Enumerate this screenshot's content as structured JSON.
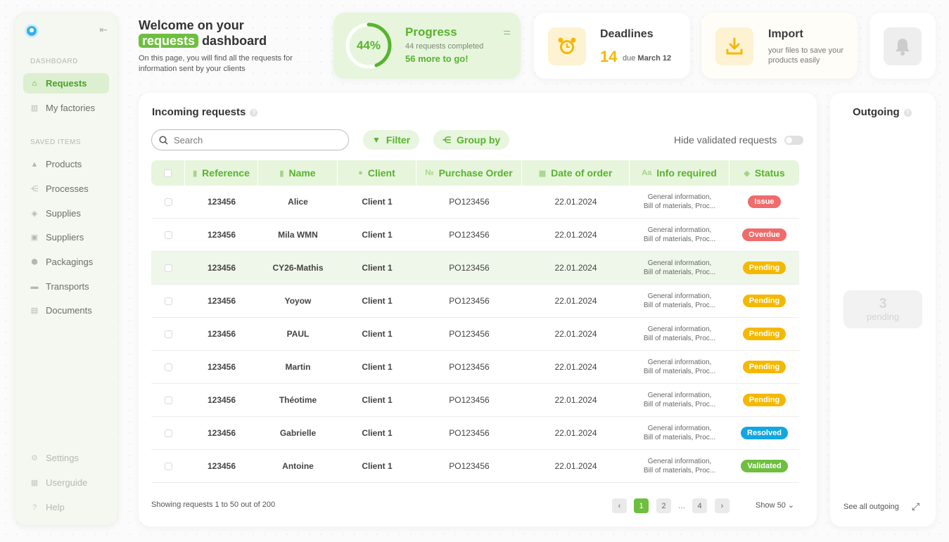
{
  "sidebar": {
    "section_dashboard": "DASHBOARD",
    "section_saved": "SAVED ITEMS",
    "items": [
      {
        "label": "Requests",
        "icon": "home-icon"
      },
      {
        "label": "My factories",
        "icon": "factory-icon"
      },
      {
        "label": "Products",
        "icon": "boxes-icon"
      },
      {
        "label": "Processes",
        "icon": "process-icon"
      },
      {
        "label": "Supplies",
        "icon": "layers-icon"
      },
      {
        "label": "Suppliers",
        "icon": "contact-icon"
      },
      {
        "label": "Packagings",
        "icon": "package-icon"
      },
      {
        "label": "Transports",
        "icon": "truck-icon"
      },
      {
        "label": "Documents",
        "icon": "document-icon"
      },
      {
        "label": "Settings",
        "icon": "gear-icon"
      },
      {
        "label": "Userguide",
        "icon": "book-icon"
      },
      {
        "label": "Help",
        "icon": "help-icon"
      }
    ]
  },
  "welcome": {
    "title_1": "Welcome on your",
    "title_highlight": "requests",
    "title_2": "dashboard",
    "desc": "On this page, you will find all the requests for information sent by your clients"
  },
  "progress": {
    "percent_label": "44%",
    "value": 0.44,
    "title": "Progress",
    "sub": "44 requests completed",
    "more": "56 more to go!"
  },
  "deadlines": {
    "title": "Deadlines",
    "count": "14",
    "due": "due",
    "date": "March 12"
  },
  "import": {
    "title": "Import",
    "sub": "your files to save your products easily"
  },
  "incoming": {
    "title": "Incoming requests",
    "search_placeholder": "Search",
    "filter_label": "Filter",
    "groupby_label": "Group by",
    "hide_label": "Hide validated requests",
    "columns": [
      "Reference",
      "Name",
      "Client",
      "Purchase Order",
      "Date of order",
      "Info required",
      "Status"
    ],
    "rows": [
      {
        "ref": "123456",
        "name": "Alice",
        "client": "Client 1",
        "po": "PO123456",
        "date": "22.01.2024",
        "info1": "General information,",
        "info2": "Bill of materials, Proc...",
        "status": "Issue"
      },
      {
        "ref": "123456",
        "name": "Mila WMN",
        "client": "Client 1",
        "po": "PO123456",
        "date": "22.01.2024",
        "info1": "General information,",
        "info2": "Bill of materials, Proc...",
        "status": "Overdue"
      },
      {
        "ref": "123456",
        "name": "CY26-Mathis",
        "client": "Client 1",
        "po": "PO123456",
        "date": "22.01.2024",
        "info1": "General information,",
        "info2": "Bill of materials, Proc...",
        "status": "Pending"
      },
      {
        "ref": "123456",
        "name": "Yoyow",
        "client": "Client 1",
        "po": "PO123456",
        "date": "22.01.2024",
        "info1": "General information,",
        "info2": "Bill of materials, Proc...",
        "status": "Pending"
      },
      {
        "ref": "123456",
        "name": "PAUL",
        "client": "Client 1",
        "po": "PO123456",
        "date": "22.01.2024",
        "info1": "General information,",
        "info2": "Bill of materials, Proc...",
        "status": "Pending"
      },
      {
        "ref": "123456",
        "name": "Martin",
        "client": "Client 1",
        "po": "PO123456",
        "date": "22.01.2024",
        "info1": "General information,",
        "info2": "Bill of materials, Proc...",
        "status": "Pending"
      },
      {
        "ref": "123456",
        "name": "Théotime",
        "client": "Client 1",
        "po": "PO123456",
        "date": "22.01.2024",
        "info1": "General information,",
        "info2": "Bill of materials, Proc...",
        "status": "Pending"
      },
      {
        "ref": "123456",
        "name": "Gabrielle",
        "client": "Client 1",
        "po": "PO123456",
        "date": "22.01.2024",
        "info1": "General information,",
        "info2": "Bill of materials, Proc...",
        "status": "Resolved"
      },
      {
        "ref": "123456",
        "name": "Antoine",
        "client": "Client 1",
        "po": "PO123456",
        "date": "22.01.2024",
        "info1": "General information,",
        "info2": "Bill of materials, Proc...",
        "status": "Validated"
      }
    ],
    "status_colors": {
      "Issue": "#f06b6b",
      "Overdue": "#f06b6b",
      "Pending": "#f5b800",
      "Resolved": "#12a7e0",
      "Validated": "#6ebf3f"
    },
    "showing": "Showing requests 1 to 50 out of 200",
    "pages": [
      "1",
      "2",
      "...",
      "4"
    ],
    "show_label": "Show 50"
  },
  "outgoing": {
    "title": "Outgoing",
    "count": "3",
    "count_label": "pending",
    "see_all": "See all outgoing"
  },
  "colors": {
    "accent": "#6ebf3f",
    "accent_light": "#e6f5dc",
    "warning": "#f5b800"
  }
}
